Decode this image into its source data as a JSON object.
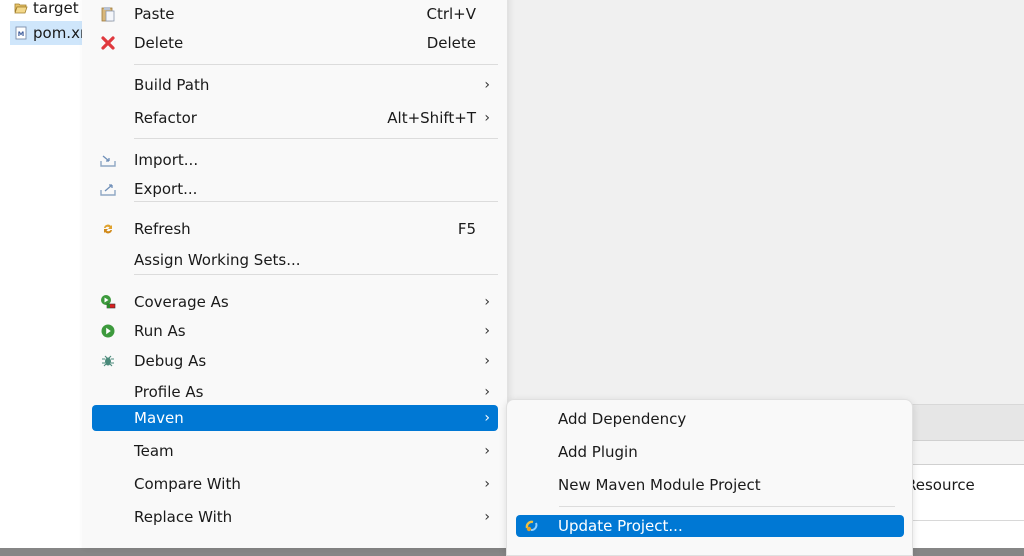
{
  "explorer": {
    "items": [
      {
        "label": "target",
        "icon": "folder-open-icon",
        "selected": false
      },
      {
        "label": "pom.xml",
        "icon": "maven-pom-file-icon",
        "selected": true
      }
    ]
  },
  "bottom_panel": {
    "cell_text": "Resource"
  },
  "context_menu": {
    "items": [
      {
        "label": "Paste",
        "accel": "Ctrl+V",
        "icon": "paste-icon"
      },
      {
        "label": "Delete",
        "accel": "Delete",
        "icon": "delete-icon"
      },
      {
        "label": "Build Path",
        "submenu": true
      },
      {
        "label": "Refactor",
        "accel": "Alt+Shift+T",
        "submenu": true
      },
      {
        "label": "Import...",
        "icon": "import-icon"
      },
      {
        "label": "Export...",
        "icon": "export-icon"
      },
      {
        "label": "Refresh",
        "accel": "F5",
        "icon": "refresh-icon"
      },
      {
        "label": "Assign Working Sets..."
      },
      {
        "label": "Coverage As",
        "icon": "coverage-icon",
        "submenu": true
      },
      {
        "label": "Run As",
        "icon": "run-icon",
        "submenu": true
      },
      {
        "label": "Debug As",
        "icon": "debug-icon",
        "submenu": true
      },
      {
        "label": "Profile As",
        "submenu": true
      },
      {
        "label": "Maven",
        "submenu": true,
        "active": true
      },
      {
        "label": "Team",
        "submenu": true
      },
      {
        "label": "Compare With",
        "submenu": true
      },
      {
        "label": "Replace With",
        "submenu": true
      }
    ],
    "arrow_glyph": "›"
  },
  "maven_submenu": {
    "items": [
      {
        "label": "Add Dependency"
      },
      {
        "label": "Add Plugin"
      },
      {
        "label": "New Maven Module Project"
      },
      {
        "label": "Update Project...",
        "icon": "maven-update-icon",
        "active": true
      }
    ]
  },
  "colors": {
    "accent": "#0078d4",
    "menu_bg": "#f9f9f9",
    "selection_bg": "#cfe6fb"
  }
}
